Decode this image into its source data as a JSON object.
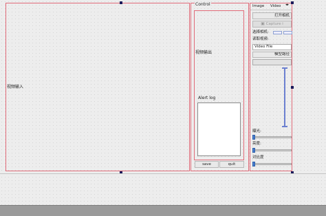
{
  "video_input": {
    "label": "视频输入"
  },
  "control": {
    "group_title": "Control",
    "video_output_label": "视频输出",
    "alert_log_title": "Alert log",
    "save_label": "save",
    "quit_label": "quit"
  },
  "right_panel": {
    "tabs": [
      "Image",
      "Video"
    ],
    "open_camera_label": "打开相机",
    "capture_label": "Capture i",
    "select_camera_label": "选择相机:",
    "read_video_label": "读取视频:",
    "video_file_label": "Video File",
    "model_path_label": "模型路径",
    "exposure_label": "曝光:",
    "brightness_label": "亮度:",
    "contrast_label": "对比度"
  },
  "sliders": {
    "exposure_value": 0.0,
    "brightness_value": 0.0,
    "contrast_value": 0.0
  },
  "colors": {
    "frame_border": "#e06a78",
    "accent": "#4a7fd0",
    "status_bar": "#9a9a9a"
  }
}
